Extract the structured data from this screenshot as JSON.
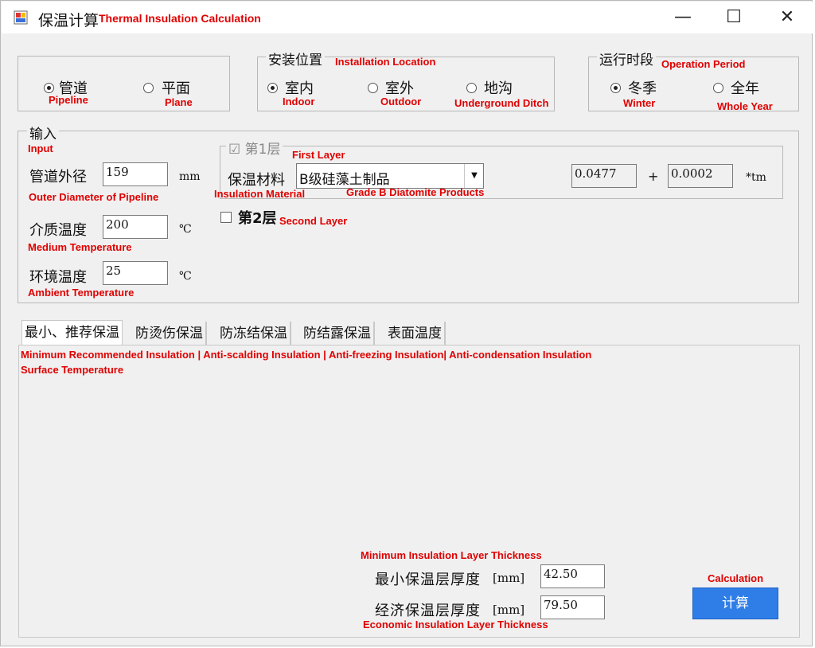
{
  "window": {
    "title_cn": "保温计算",
    "title_en": "Thermal Insulation Calculation",
    "minimize_glyph": "—",
    "maximize_glyph": "☐",
    "close_glyph": "✕"
  },
  "pipe_type": {
    "options": [
      {
        "cn": "管道",
        "en": "Pipeline",
        "selected": true
      },
      {
        "cn": "平面",
        "en": "Plane",
        "selected": false
      }
    ]
  },
  "install_location": {
    "legend_cn": "安装位置",
    "legend_en": "Installation Location",
    "options": [
      {
        "cn": "室内",
        "en": "Indoor",
        "selected": true
      },
      {
        "cn": "室外",
        "en": "Outdoor",
        "selected": false
      },
      {
        "cn": "地沟",
        "en": "Underground Ditch",
        "selected": false
      }
    ]
  },
  "operation_period": {
    "legend_cn": "运行时段",
    "legend_en": "Operation Period",
    "options": [
      {
        "cn": "冬季",
        "en": "Winter",
        "selected": true
      },
      {
        "cn": "全年",
        "en": "Whole Year",
        "selected": false
      }
    ]
  },
  "input": {
    "legend_cn": "输入",
    "legend_en": "Input",
    "outer_diameter": {
      "label_cn": "管道外径",
      "label_en": "Outer Diameter of Pipeline",
      "value": "159",
      "unit": "mm"
    },
    "medium_temp": {
      "label_cn": "介质温度",
      "label_en": "Medium Temperature",
      "value": "200",
      "unit": "℃"
    },
    "ambient_temp": {
      "label_cn": "环境温度",
      "label_en": "Ambient Temperature",
      "value": "25",
      "unit": "℃"
    }
  },
  "first_layer": {
    "check_glyph": "☑",
    "label_cn": "第1层",
    "label_en": "First Layer",
    "material_label_cn": "保温材料",
    "material_label_en": "Insulation Material",
    "material_value": "B级硅藻土制品",
    "material_value_en": "Grade B Diatomite Products",
    "coef_a": "0.0477",
    "plus": "+",
    "coef_b": "0.0002",
    "coef_unit": "*tm"
  },
  "second_layer": {
    "label_cn": "第2层",
    "label_en": "Second Layer",
    "checked": false
  },
  "tabs": [
    {
      "label": "最小、推荐保温",
      "active": true
    },
    {
      "label": "防烫伤保温",
      "active": false
    },
    {
      "label": "防冻结保温",
      "active": false
    },
    {
      "label": "防结露保温",
      "active": false
    },
    {
      "label": "表面温度",
      "active": false
    }
  ],
  "tabs_en_line1": "Minimum Recommended Insulation | Anti-scalding Insulation | Anti-freezing Insulation| Anti-condensation Insulation",
  "tabs_en_line2": "Surface Temperature",
  "results": {
    "min_thickness": {
      "label_cn": "最小保温层厚度",
      "label_en": "Minimum Insulation Layer Thickness",
      "unit": "[mm]",
      "value": "42.50"
    },
    "econ_thickness": {
      "label_cn": "经济保温层厚度",
      "label_en": "Economic Insulation Layer Thickness",
      "unit": "[mm]",
      "value": "79.50"
    }
  },
  "calc_button": {
    "label_cn": "计算",
    "label_en": "Calculation"
  },
  "colors": {
    "annotation": "#e00000",
    "button": "#2f7ee8",
    "window_bg": "#f0f0f0"
  }
}
